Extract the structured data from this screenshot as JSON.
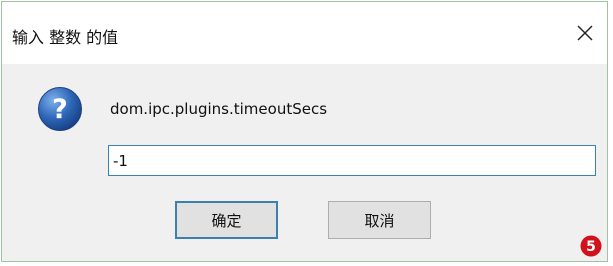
{
  "window": {
    "title": "输入 整数 的值",
    "close_icon": "close-icon"
  },
  "dialog": {
    "icon": "question-icon",
    "prompt": "dom.ipc.plugins.timeoutSecs",
    "input_value": "-1"
  },
  "buttons": {
    "ok_label": "确定",
    "cancel_label": "取消"
  },
  "annotation": {
    "marker_number": "5",
    "marker_color": "#d2121a"
  },
  "colors": {
    "accent": "#3c7fb1",
    "icon_blue": "#2f67b8"
  }
}
